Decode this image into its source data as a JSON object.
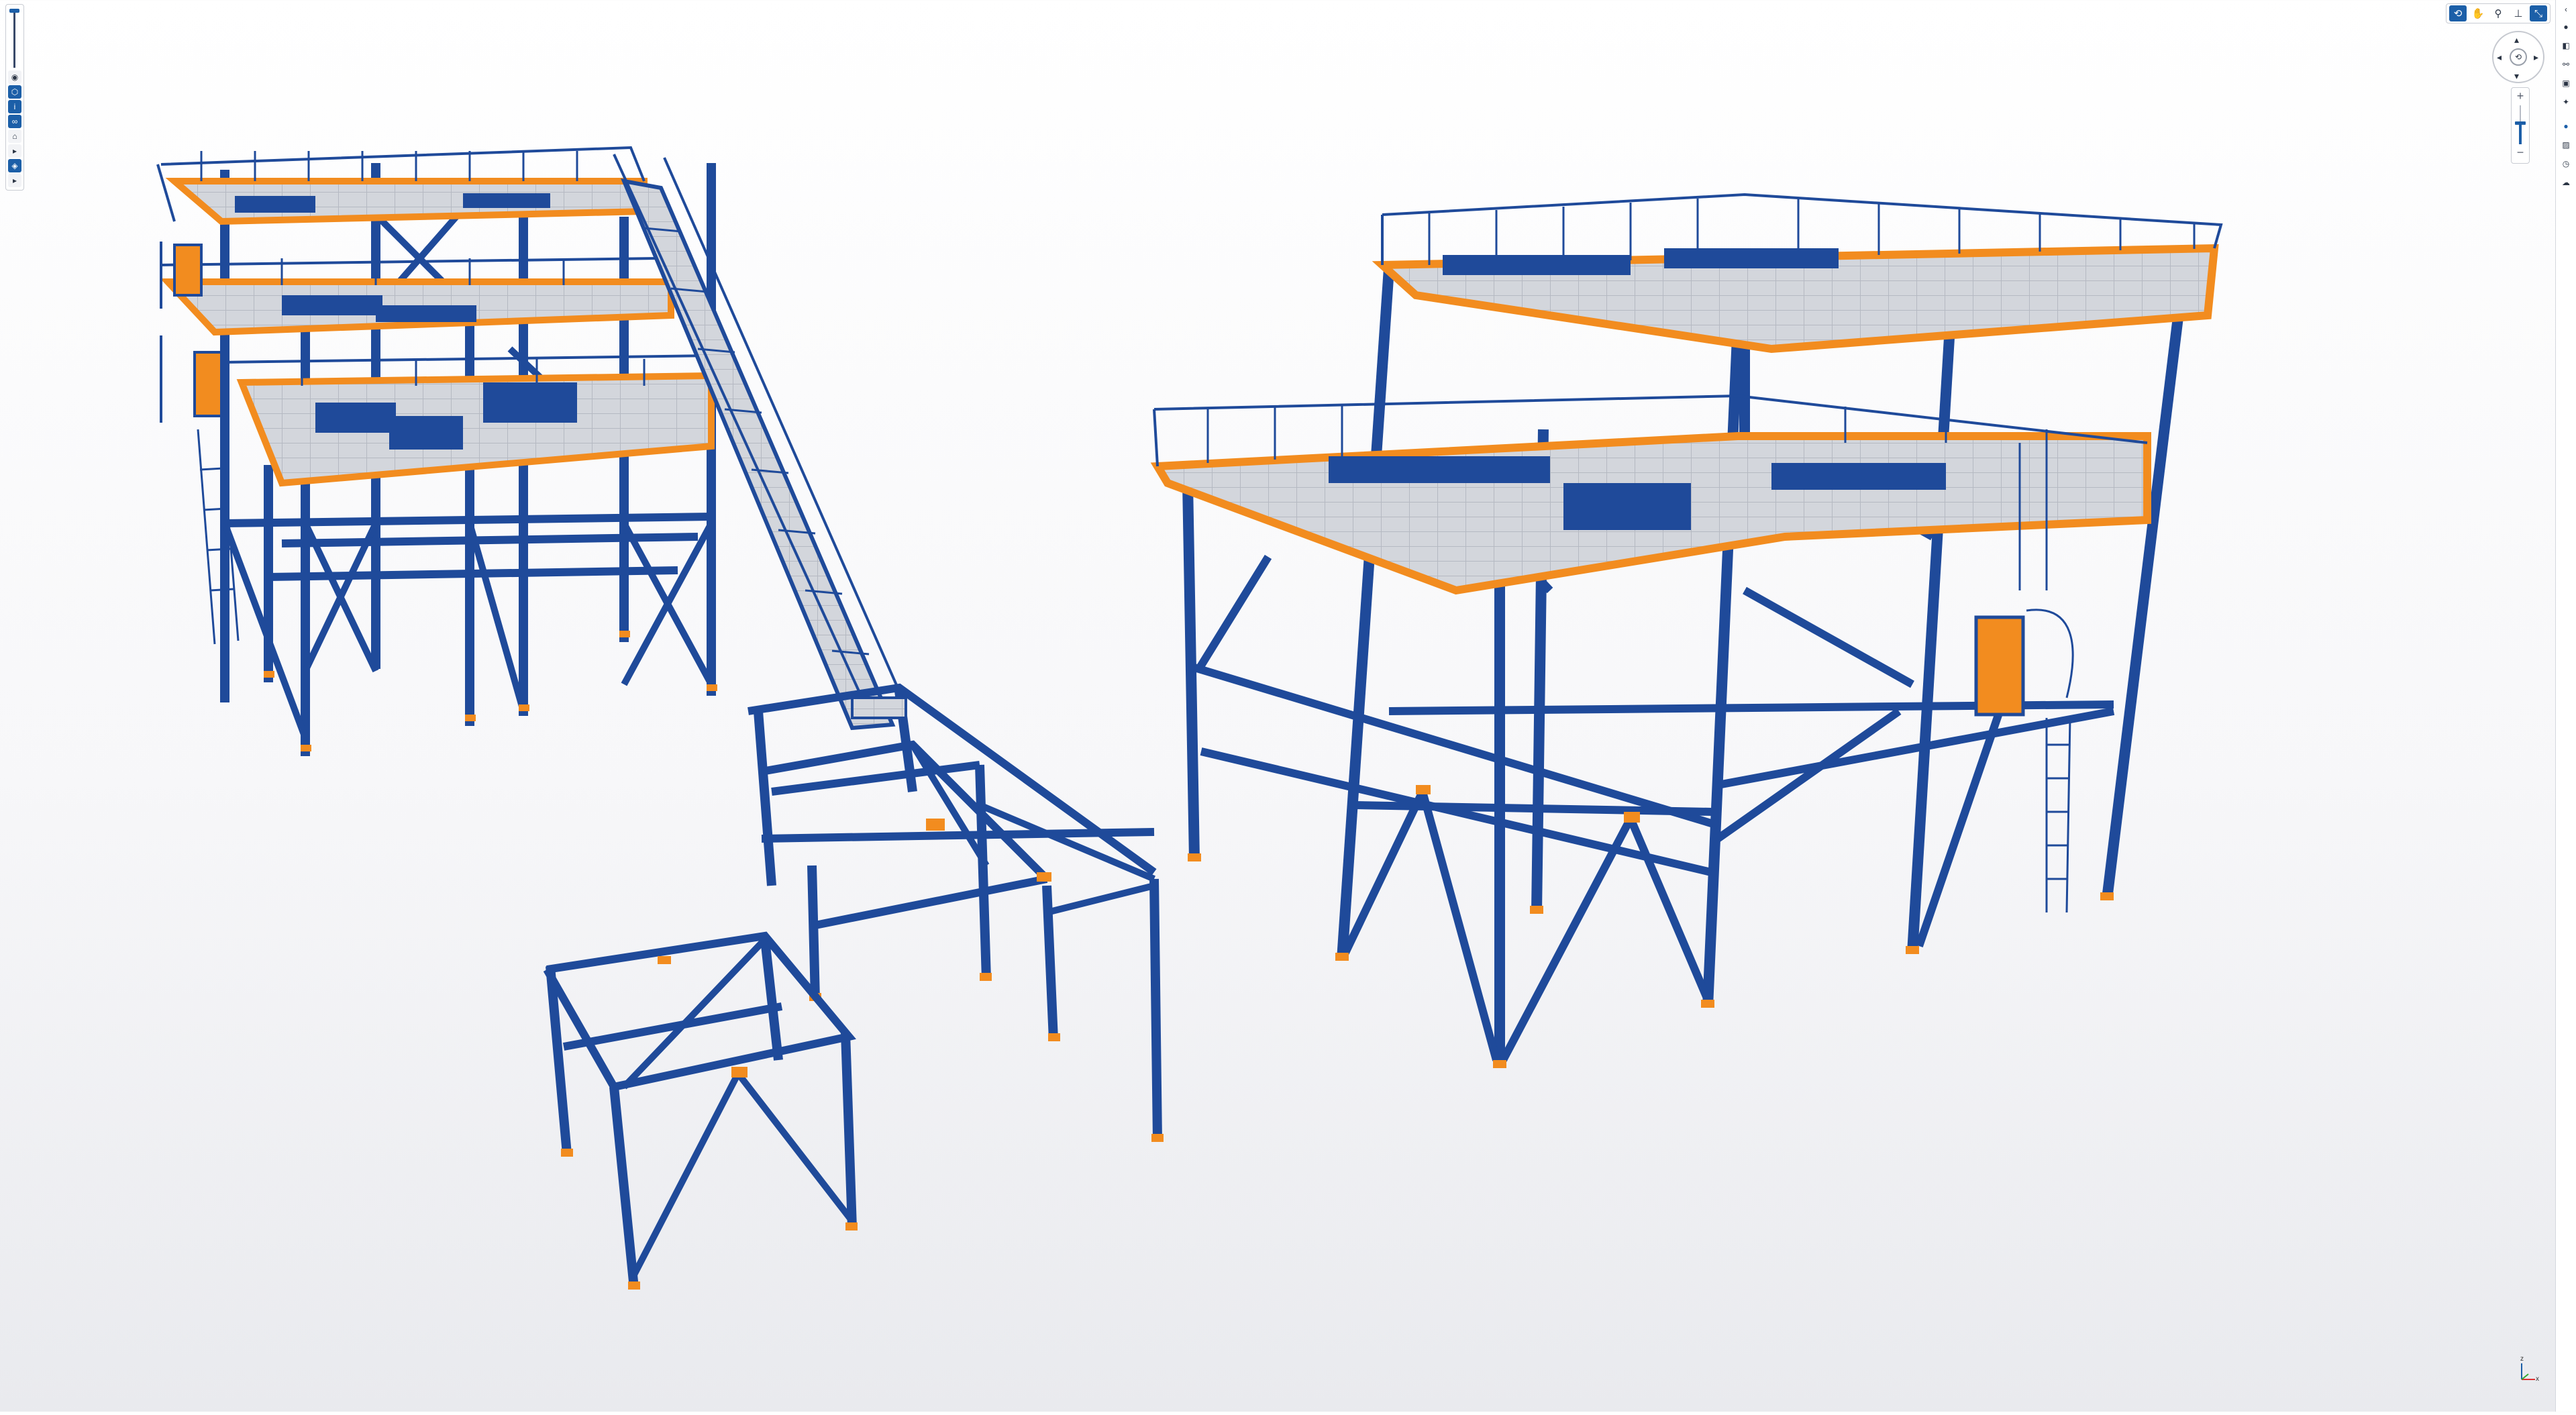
{
  "colors": {
    "steel": "#1f4a9a",
    "steel_dark": "#143678",
    "plate": "#f28c1f",
    "grating": "#cfd3da",
    "accent": "#1c5fa8"
  },
  "left_toolbar": {
    "slider_icon": "clip-slider-icon",
    "buttons": [
      {
        "name": "eye-icon",
        "glyph": "◉",
        "active": false
      },
      {
        "name": "shield-icon",
        "glyph": "⬡",
        "active": true
      },
      {
        "name": "info-icon",
        "glyph": "i",
        "active": true
      },
      {
        "name": "link-icon",
        "glyph": "∞",
        "active": true
      },
      {
        "name": "house-icon",
        "glyph": "⌂",
        "active": false
      },
      {
        "name": "play-small-icon",
        "glyph": "▸",
        "active": false
      },
      {
        "name": "cube-icon",
        "glyph": "◈",
        "active": true
      },
      {
        "name": "play-icon",
        "glyph": "▸",
        "active": false
      }
    ]
  },
  "nav_toolbar": {
    "buttons": [
      {
        "name": "orbit-icon",
        "glyph": "⟲",
        "active": true
      },
      {
        "name": "pan-hand-icon",
        "glyph": "✋",
        "active": false
      },
      {
        "name": "walk-icon",
        "glyph": "⚲",
        "active": false
      },
      {
        "name": "section-icon",
        "glyph": "⊥",
        "active": false
      },
      {
        "name": "fit-view-icon",
        "glyph": "⤡",
        "active": true
      }
    ]
  },
  "orbit": {
    "up": "▴",
    "down": "▾",
    "left": "◂",
    "right": "▸",
    "center": "⟲"
  },
  "zoom": {
    "plus": "+",
    "minus": "−"
  },
  "right_panel": {
    "buttons": [
      {
        "name": "collapse-panel-icon",
        "glyph": "‹",
        "active": false
      },
      {
        "name": "model-icon",
        "glyph": "●",
        "active": false
      },
      {
        "name": "layers-icon",
        "glyph": "◧",
        "active": false
      },
      {
        "name": "search-objects-icon",
        "glyph": "⚯",
        "active": false
      },
      {
        "name": "views-icon",
        "glyph": "▣",
        "active": false
      },
      {
        "name": "settings-icon",
        "glyph": "✦",
        "active": false
      },
      {
        "name": "properties-icon",
        "glyph": "●",
        "active": true
      },
      {
        "name": "image-icon",
        "glyph": "▨",
        "active": false
      },
      {
        "name": "history-icon",
        "glyph": "◷",
        "active": false
      },
      {
        "name": "cloud-icon",
        "glyph": "☁",
        "active": false
      }
    ]
  },
  "axis": {
    "z": "z",
    "x": "x"
  }
}
